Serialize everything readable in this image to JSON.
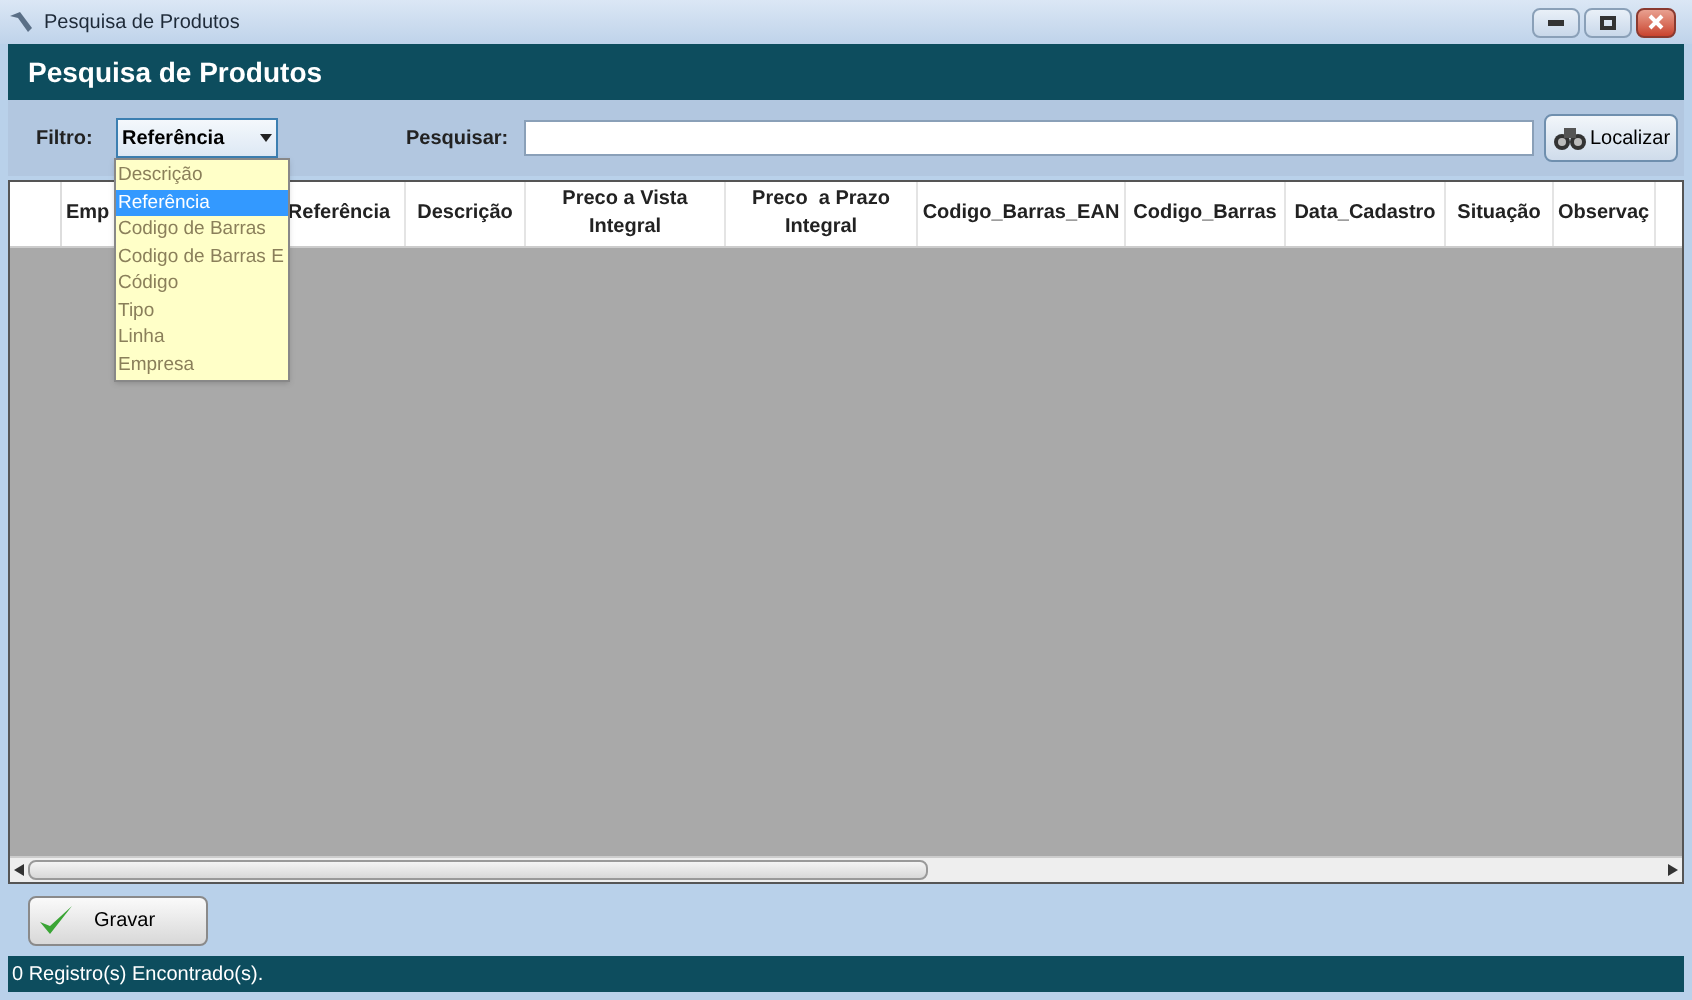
{
  "window": {
    "title": "Pesquisa de Produtos"
  },
  "header": {
    "title": "Pesquisa de Produtos"
  },
  "filter": {
    "label": "Filtro:",
    "value": "Referência",
    "expanded": true,
    "options": [
      {
        "label": "Descrição",
        "selected": false
      },
      {
        "label": "Referência",
        "selected": true
      },
      {
        "label": "Codigo de Barras",
        "selected": false
      },
      {
        "label": "Codigo de Barras E",
        "selected": false
      },
      {
        "label": "Código",
        "selected": false
      },
      {
        "label": "Tipo",
        "selected": false
      },
      {
        "label": "Linha",
        "selected": false
      },
      {
        "label": "Empresa",
        "selected": false
      }
    ]
  },
  "search": {
    "label": "Pesquisar:",
    "button": "Localizar"
  },
  "table": {
    "columns": [
      {
        "label": "Emp"
      },
      {
        "label": "Referência"
      },
      {
        "label": "Descrição"
      },
      {
        "label": "Preco a Vista Integral"
      },
      {
        "label": "Preco  a Prazo Integral"
      },
      {
        "label": "Codigo_Barras_EAN"
      },
      {
        "label": "Codigo_Barras"
      },
      {
        "label": "Data_Cadastro"
      },
      {
        "label": "Situação"
      },
      {
        "label": "Observaç"
      }
    ]
  },
  "buttons": [
    "Gravar"
  ],
  "status_bar": "0 Registro(s) Encontrado(s)."
}
